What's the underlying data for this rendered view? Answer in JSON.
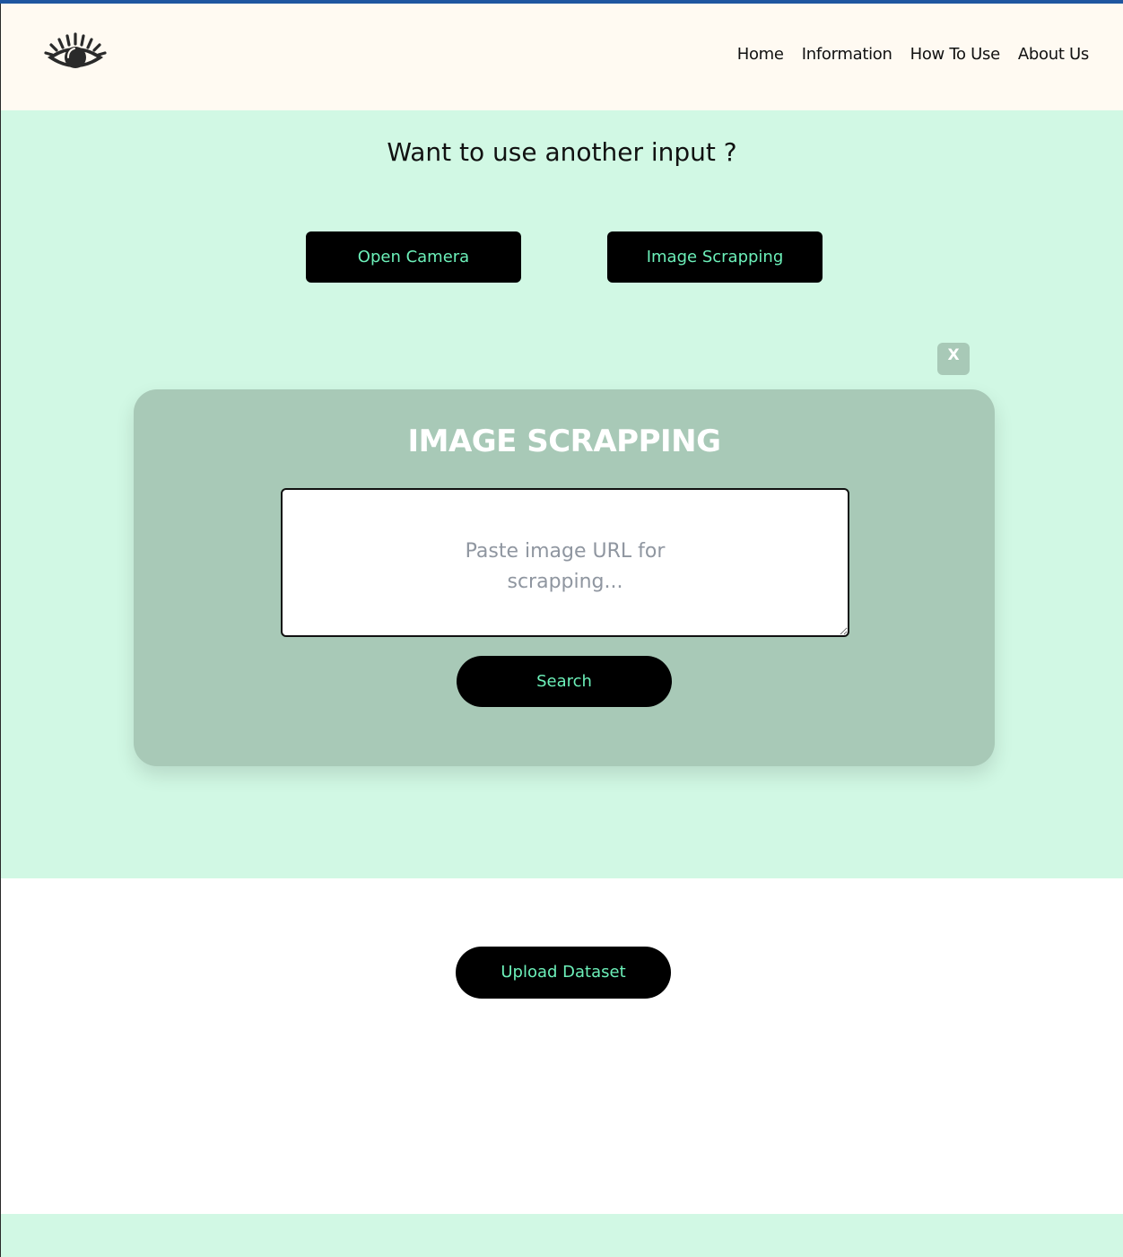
{
  "header": {
    "logo_icon": "eye-logo-icon",
    "nav": [
      {
        "label": "Home"
      },
      {
        "label": "Information"
      },
      {
        "label": "How To Use"
      },
      {
        "label": "About Us"
      }
    ]
  },
  "input_section": {
    "title": "Want to use another input ?",
    "open_camera_label": "Open Camera",
    "image_scrapping_label": "Image Scrapping",
    "close_label": "X"
  },
  "modal": {
    "title": "IMAGE SCRAPPING",
    "url_placeholder": "Paste image URL for scrapping...",
    "url_value": "",
    "search_label": "Search"
  },
  "upload": {
    "label": "Upload Dataset"
  },
  "colors": {
    "accent_text": "#6cf0b9",
    "section_bg": "#d1f8e4",
    "modal_bg": "#a8c9b7",
    "header_bg": "#fffaf2",
    "top_strip": "#1f56a0"
  }
}
